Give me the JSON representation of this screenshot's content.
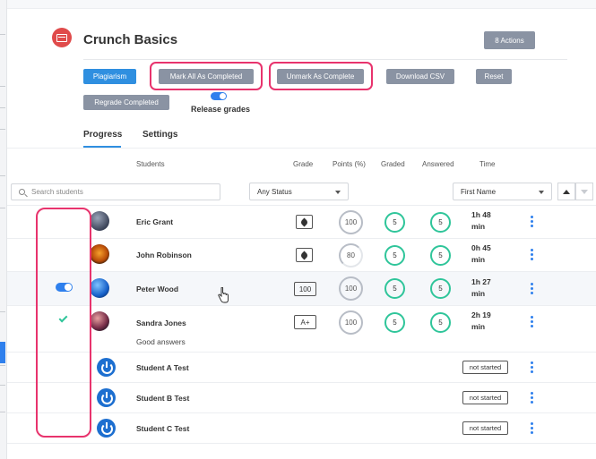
{
  "header": {
    "title": "Crunch Basics",
    "actions_label": "8 Actions"
  },
  "toolbar": {
    "plagiarism": "Plagiarism",
    "mark_all": "Mark All As Completed",
    "unmark": "Unmark As Complete",
    "download_csv": "Download CSV",
    "reset": "Reset",
    "regrade": "Regrade Completed",
    "release_grades": "Release grades",
    "release_grades_on": true
  },
  "tabs": [
    "Progress",
    "Settings"
  ],
  "active_tab": "Progress",
  "columns": {
    "students": "Students",
    "grade": "Grade",
    "points": "Points (%)",
    "graded": "Graded",
    "answered": "Answered",
    "time": "Time"
  },
  "filters": {
    "search_placeholder": "Search students",
    "status": "Any Status",
    "sort_by": "First Name"
  },
  "students": [
    {
      "name": "Eric Grant",
      "grade": "pencil-icon",
      "points": "100",
      "graded": "5",
      "answered": "5",
      "time_line1": "1h 48",
      "time_line2": "min"
    },
    {
      "name": "John Robinson",
      "grade": "pencil-icon",
      "points": "80",
      "graded": "5",
      "answered": "5",
      "time_line1": "0h 45",
      "time_line2": "min"
    },
    {
      "name": "Peter Wood",
      "grade": "100",
      "points": "100",
      "graded": "5",
      "answered": "5",
      "time_line1": "1h 27",
      "time_line2": "min",
      "toggle_on": true
    },
    {
      "name": "Sandra Jones",
      "note": "Good answers",
      "grade": "A+",
      "points": "100",
      "graded": "5",
      "answered": "5",
      "time_line1": "2h 19",
      "time_line2": "min",
      "completed": true
    },
    {
      "name": "Student A Test",
      "status": "not started"
    },
    {
      "name": "Student B Test",
      "status": "not started"
    },
    {
      "name": "Student C Test",
      "status": "not started"
    }
  ],
  "colors": {
    "accent": "#2f8fe0",
    "highlight": "#e8336d",
    "success": "#2fc59a",
    "gray_button": "#8a93a3"
  }
}
